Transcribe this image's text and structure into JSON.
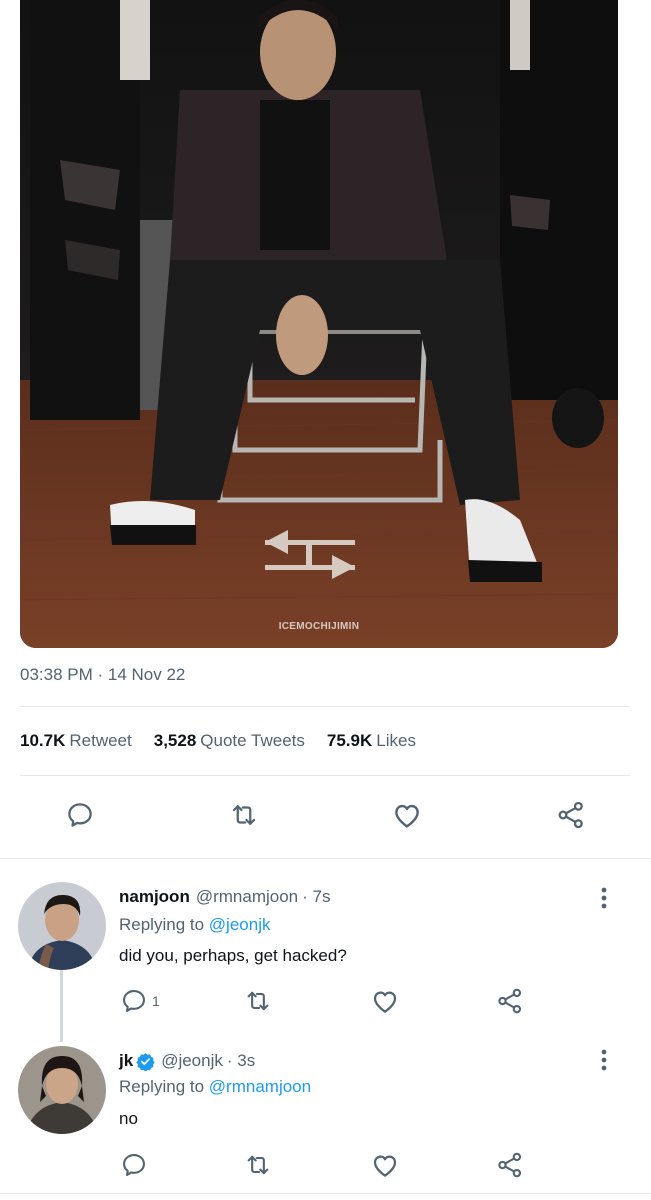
{
  "media": {
    "watermark": "ICEMOCHIJIMIN"
  },
  "tweet": {
    "timestamp": "03:38 PM · 14 Nov 22",
    "stats": [
      {
        "value": "10.7K",
        "label": "Retweet"
      },
      {
        "value": "3,528",
        "label": "Quote Tweets"
      },
      {
        "value": "75.9K",
        "label": "Likes"
      }
    ]
  },
  "replies": [
    {
      "name": "namjoon",
      "handle": "@rmnamjoon",
      "time": "· 7s",
      "replying_prefix": "Replying to",
      "replying_to": "@jeonjk",
      "text": "did you, perhaps, get hacked?",
      "reply_count": "1",
      "verified": false
    },
    {
      "name": "jk",
      "handle": "@jeonjk",
      "time": "· 3s",
      "replying_prefix": "Replying to",
      "replying_to": "@rmnamjoon",
      "text": "no",
      "reply_count": "",
      "verified": true
    }
  ],
  "colors": {
    "accent": "#1d9bf0",
    "secondary_text": "#536471",
    "icon": "#536471"
  },
  "icons": [
    "reply-icon",
    "retweet-icon",
    "like-icon",
    "share-icon",
    "more-icon",
    "verified-badge-icon"
  ]
}
